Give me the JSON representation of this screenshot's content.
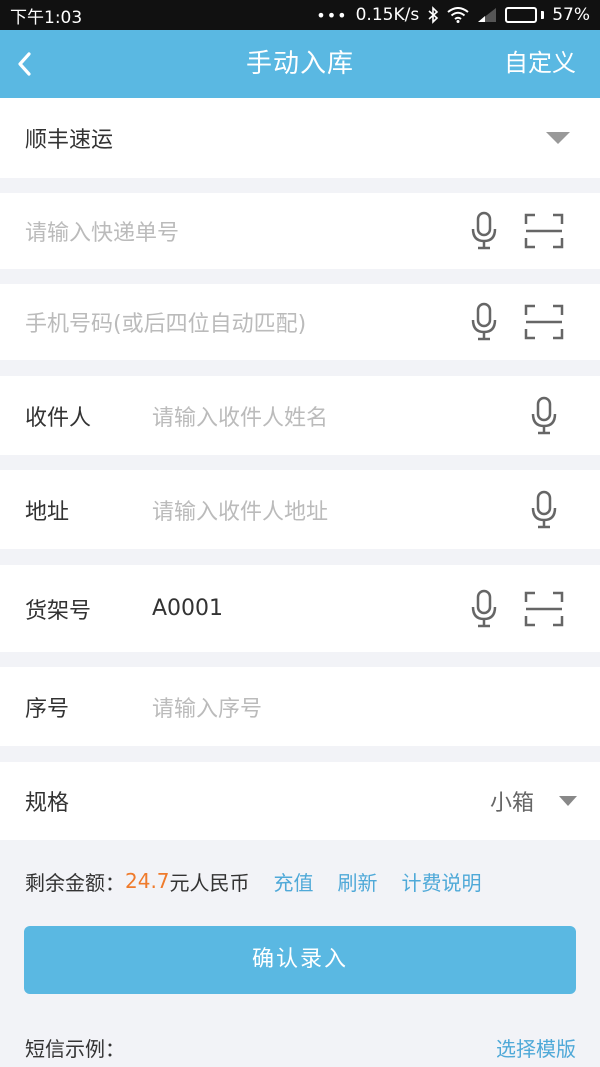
{
  "status": {
    "time": "下午1:03",
    "dots": "•••",
    "speed": "0.15K/s",
    "battery": "57%",
    "battery_level": 0.57
  },
  "nav": {
    "title": "手动入库",
    "right": "自定义"
  },
  "courier": {
    "value": "顺丰速运"
  },
  "tracking": {
    "placeholder": "请输入快递单号"
  },
  "phone": {
    "placeholder": "手机号码(或后四位自动匹配)"
  },
  "recipient": {
    "label": "收件人",
    "placeholder": "请输入收件人姓名"
  },
  "address": {
    "label": "地址",
    "placeholder": "请输入收件人地址"
  },
  "shelf": {
    "label": "货架号",
    "value": "A0001"
  },
  "serial": {
    "label": "序号",
    "placeholder": "请输入序号"
  },
  "spec": {
    "label": "规格",
    "value": "小箱"
  },
  "balance": {
    "label": "剩余金额：",
    "amount": "24.7",
    "unit": "元人民币",
    "recharge": "充值",
    "refresh": "刷新",
    "pricing": "计费说明"
  },
  "confirm_label": "确认录入",
  "sms": {
    "label": "短信示例：",
    "select_template": "选择模版"
  },
  "colors": {
    "primary": "#5ab8e2",
    "link": "#4fa9d8",
    "amount": "#ef7b2c"
  }
}
